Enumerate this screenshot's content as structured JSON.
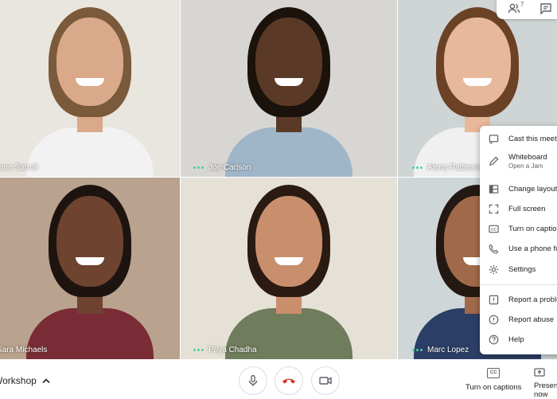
{
  "participants": [
    {
      "name": "Jane Sarroll",
      "bg": "#e9e5df",
      "skin": "#d9a98a",
      "hair": "#7a5a3a",
      "shirt": "#f2f2f2",
      "speaking": false
    },
    {
      "name": "Joe Carlson",
      "bg": "#d8d6d2",
      "skin": "#5a3a26",
      "hair": "#1b120c",
      "shirt": "#9fb6c9",
      "speaking": true
    },
    {
      "name": "Alena Patterson",
      "bg": "#cfd4d4",
      "skin": "#e8b89a",
      "hair": "#6b4226",
      "shirt": "#f0f0f0",
      "speaking": true
    },
    {
      "name": "Sara Michaels",
      "bg": "#b9a38e",
      "skin": "#6e4330",
      "hair": "#1d1410",
      "shirt": "#7a2c36",
      "speaking": false
    },
    {
      "name": "Priya Chadha",
      "bg": "#e6e1d6",
      "skin": "#c98f6d",
      "hair": "#2a1a12",
      "shirt": "#6f7d5c",
      "speaking": true
    },
    {
      "name": "Marc Lopez",
      "bg": "#cfd6d8",
      "skin": "#a06a4a",
      "hair": "#241812",
      "shirt": "#2b3f66",
      "speaking": true
    }
  ],
  "top_controls": {
    "people_count": "7"
  },
  "menu": {
    "items": [
      {
        "label": "Cast this meeting",
        "icon": "cast-icon"
      },
      {
        "label": "Whiteboard",
        "sub": "Open a Jam",
        "icon": "pen-icon"
      },
      {
        "label": "Change layout",
        "icon": "layout-icon"
      },
      {
        "label": "Full screen",
        "icon": "fullscreen-icon"
      },
      {
        "label": "Turn on captions",
        "icon": "captions-icon"
      },
      {
        "label": "Use a phone for audio",
        "icon": "phone-icon"
      },
      {
        "label": "Settings",
        "icon": "gear-icon"
      },
      {
        "label": "Report a problem",
        "icon": "report-icon"
      },
      {
        "label": "Report abuse",
        "icon": "alert-icon"
      },
      {
        "label": "Help",
        "icon": "help-icon"
      }
    ]
  },
  "bottom_bar": {
    "meeting_name": "Workshop",
    "captions_label": "Turn on captions",
    "present_label": "Present now",
    "cc_text": "CC"
  },
  "colors": {
    "end_call": "#d93025",
    "speaking": "#4dd0a3"
  }
}
